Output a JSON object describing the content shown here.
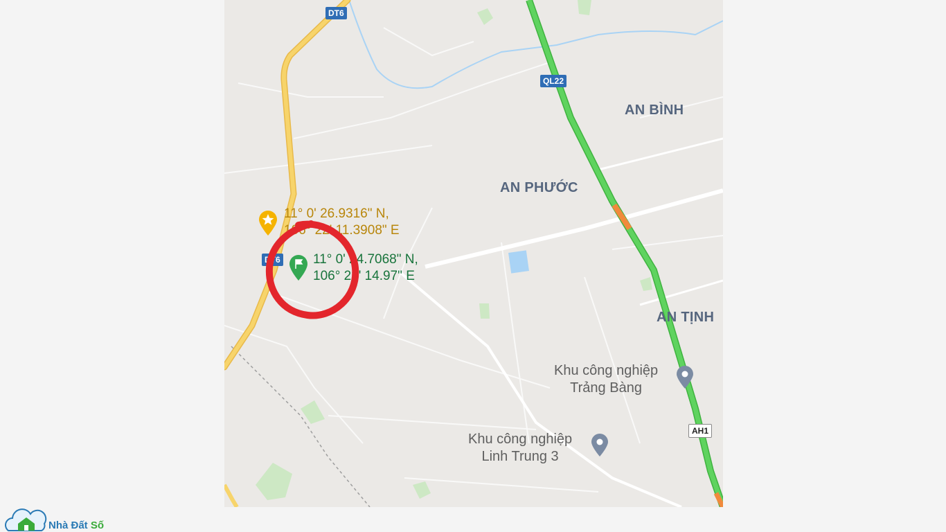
{
  "map": {
    "areas": [
      "AN BÌNH",
      "AN PHƯỚC",
      "AN TỊNH"
    ],
    "road_shields": {
      "dt6_top": "DT6",
      "ql22": "QL22",
      "dt6_mid": "DT6",
      "ah1": "AH1"
    },
    "markers": {
      "starred_place": {
        "line1": "11° 0' 26.9316\" N,",
        "line2": "106° 22' 11.3908\" E",
        "icon": "star-pin-icon",
        "color": "#f5b300"
      },
      "dropped_pin": {
        "line1": "11° 0' 24.7068\" N,",
        "line2": "106° 22' 14.97\" E",
        "icon": "flag-pin-icon",
        "color": "#34a853"
      }
    },
    "pois": [
      {
        "line1": "Khu công nghiệp",
        "line2": "Trảng Bàng",
        "icon": "place-pin-icon"
      },
      {
        "line1": "Khu công nghiệp",
        "line2": "Linh Trung 3",
        "icon": "place-pin-icon"
      }
    ],
    "annotation": {
      "shape": "hand-drawn circle",
      "color": "#e3262c"
    },
    "colors": {
      "highway_traffic": "#5fd35f",
      "slow_traffic": "#f08a3c",
      "provincial_road": "#f7d46b",
      "water": "#a9d3f5",
      "park": "#cde8c4"
    }
  },
  "brand": {
    "name_part1": "Nhà Đất ",
    "name_part2": "Số",
    "color1": "#2a7ab5",
    "color2": "#3aab3a"
  }
}
